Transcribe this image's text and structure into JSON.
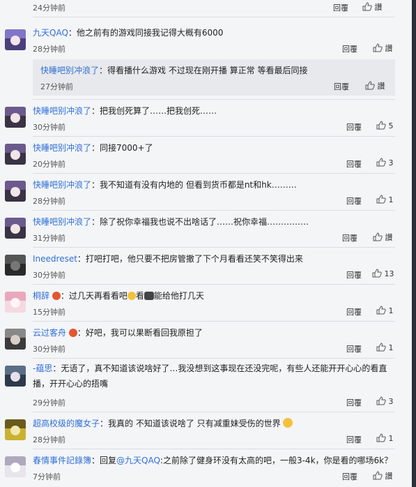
{
  "colors": {
    "user": "#2f6fd8",
    "background": "#f4f5f7",
    "subreply": "#e8e9ec"
  },
  "reply_label": "回覆",
  "comments": [
    {
      "id": "c0",
      "time": "24分钟前",
      "like": "讚"
    },
    {
      "id": "c1",
      "user": "九天QAQ",
      "text": "：他之前有的游戏同接我记得大概有6000",
      "time": "28分钟前",
      "like": "讚",
      "sub": {
        "user": "快睡吧别冲浪了",
        "text": "：得看播什么游戏 不过现在刚开播 算正常 等看最后同接",
        "time": "27分钟前",
        "like": "讚"
      }
    },
    {
      "id": "c2",
      "user": "快睡吧别冲浪了",
      "text": "：把我创死算了……把我创死……",
      "time": "30分钟前",
      "like": "5"
    },
    {
      "id": "c3",
      "user": "快睡吧别冲浪了",
      "text": "：同接7000+了",
      "time": "20分钟前",
      "like": "3"
    },
    {
      "id": "c4",
      "user": "快睡吧别冲浪了",
      "text": "：我不知道有没有内地的 但看到货币都是nt和hk………",
      "time": "28分钟前",
      "like": "1"
    },
    {
      "id": "c5",
      "user": "快睡吧别冲浪了",
      "text": "：除了祝你幸福我也说不出啥话了……祝你幸福……………",
      "time": "31分钟前",
      "like": "讚"
    },
    {
      "id": "c6",
      "user": "Ineedreset",
      "text": "：打吧打吧，他只要不把房管撤了下个月看看还笑不笑得出来",
      "time": "30分钟前",
      "like": "13"
    },
    {
      "id": "c7",
      "user": "桐辞",
      "text_a": "：过几天再看看吧",
      "text_b": "看",
      "text_c": "能给他打几天",
      "time": "15分钟前",
      "like": "1"
    },
    {
      "id": "c8",
      "user": "云过客舟",
      "text": "：好吧，我可以果断看回我原担了",
      "time": "30分钟前",
      "like": "1"
    },
    {
      "id": "c9",
      "user": "-蕴思",
      "text_l1": "：无语了，真不知道该说啥好了…我没想到这事现在还没完呢，有些人还能开开心心的看直",
      "text_l2": "播，开开心心的捂嘴",
      "time": "29分钟前",
      "like": "3"
    },
    {
      "id": "c10",
      "user": "超高校级的魔女子",
      "text": "：我真的 不知道该说啥了 只有减重妹受伤的世界",
      "time": "28分钟前",
      "like": "1"
    },
    {
      "id": "c11",
      "user": "春情事件記錄簿",
      "text_a": "：回复",
      "mention": "@九天QAQ",
      "text_b": ":之前除了健身环没有太高的吧，一般3-4k，你是看的哪场6k？",
      "time": "7分钟前",
      "like": "讚"
    }
  ]
}
